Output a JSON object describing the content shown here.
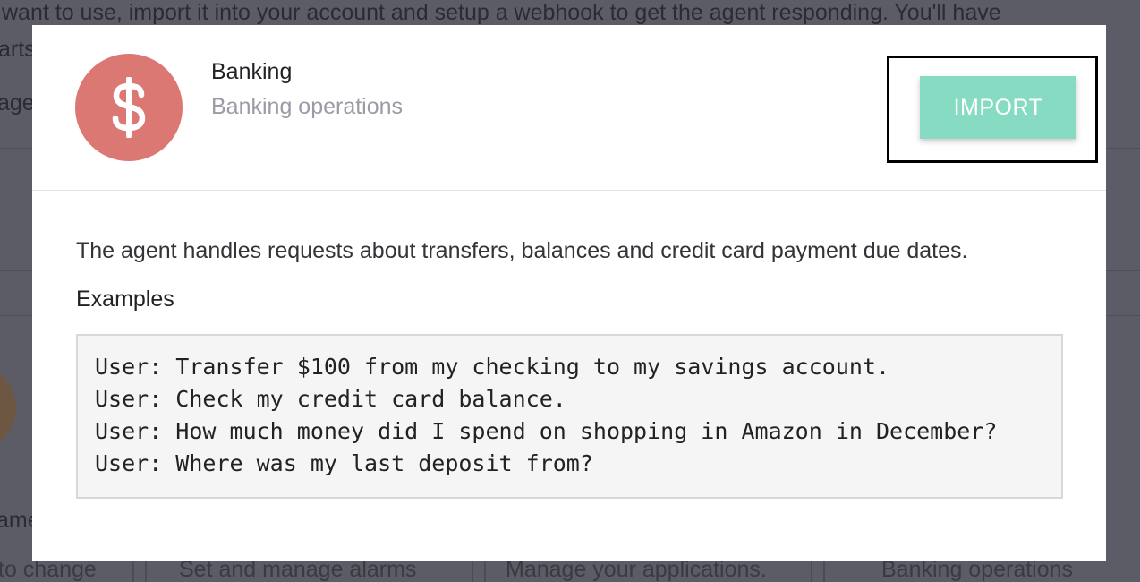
{
  "background": {
    "text_line_1": "want to use, import it into your account and setup a webhook to get the agent responding. You'll have",
    "text_line_2": "arts",
    "text_line_3": "age",
    "card_partial_name": "ame",
    "cards": [
      "to change",
      "Set and manage alarms",
      "Manage your applications.",
      "Banking operations"
    ]
  },
  "modal": {
    "agent": {
      "name": "Banking",
      "subtitle": "Banking operations",
      "icon": "dollar-sign-icon",
      "icon_glyph": "$",
      "icon_color": "#dc7874"
    },
    "import_button": {
      "label": "IMPORT",
      "color": "#88dbc3"
    },
    "description": "The agent handles requests about transfers, balances and credit card payment due dates.",
    "examples_heading": "Examples",
    "examples": [
      "User: Transfer $100 from my checking to my savings account.",
      "User: Check my credit card balance.",
      "User: How much money did I spend on shopping in Amazon in December?",
      "User: Where was my last deposit from?"
    ]
  }
}
